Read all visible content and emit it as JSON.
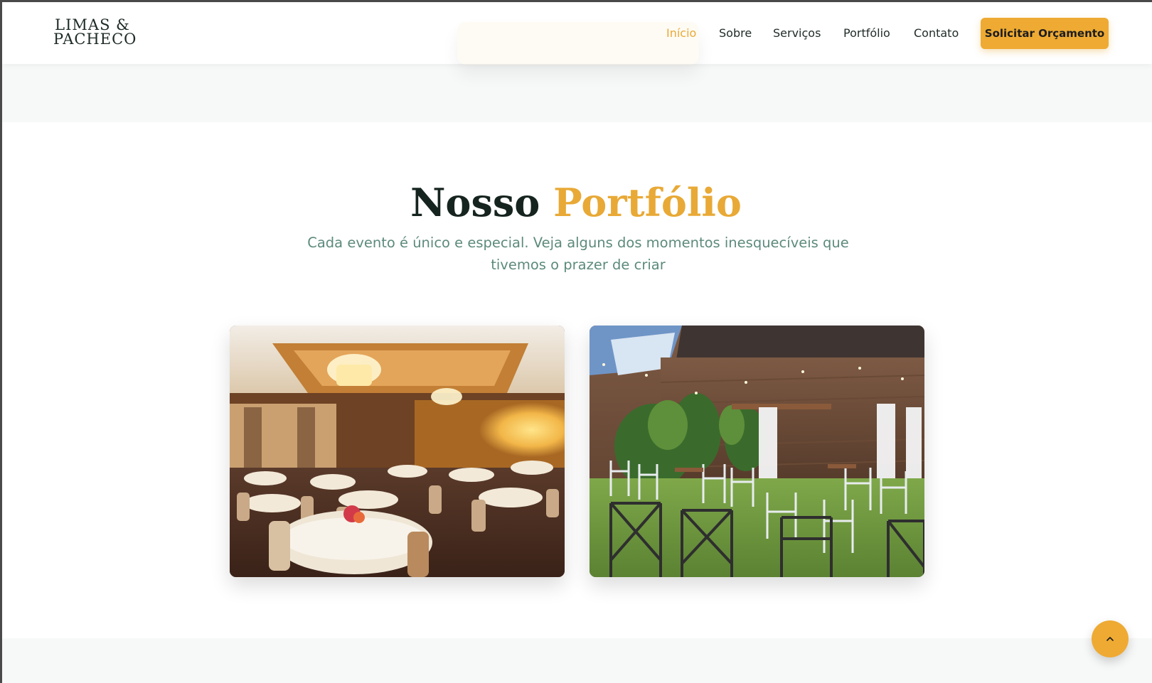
{
  "header": {
    "logo_line1": "LIMAS &",
    "logo_line2": "PACHECO",
    "nav": [
      {
        "label": "Início",
        "active": true
      },
      {
        "label": "Sobre",
        "active": false
      },
      {
        "label": "Serviços",
        "active": false
      },
      {
        "label": "Portfólio",
        "active": false
      },
      {
        "label": "Contato",
        "active": false
      }
    ],
    "cta_label": "Solicitar Orçamento"
  },
  "portfolio": {
    "title_main": "Nosso",
    "title_accent": "Portfólio",
    "subtitle": "Cada evento é único e especial. Veja alguns dos momentos inesquecíveis que tivemos o prazer de criar"
  },
  "colors": {
    "accent": "#eeaa33",
    "heading": "#16241f",
    "subtitle": "#5c8a7c"
  },
  "icons": {
    "scroll_top": "chevron-up-icon"
  }
}
